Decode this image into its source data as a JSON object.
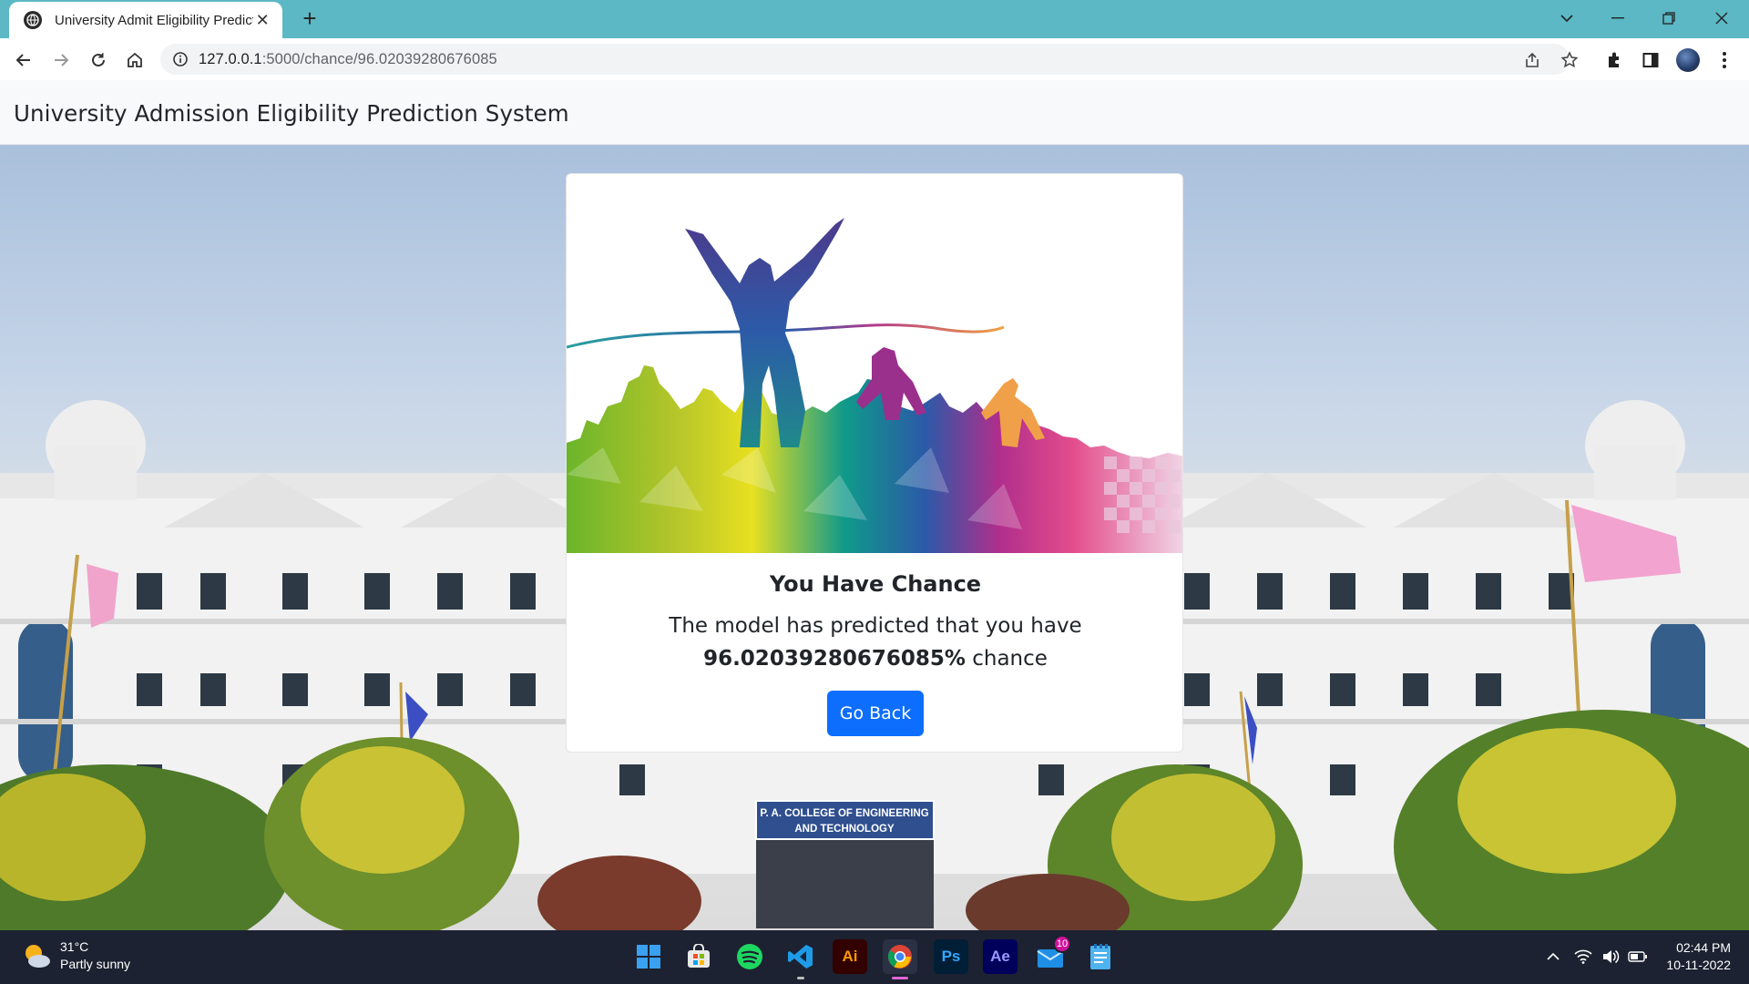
{
  "browser": {
    "tab_title": "University Admit Eligibility Prediction System",
    "url_host": "127.0.0.1",
    "url_rest": ":5000/chance/96.02039280676085",
    "icons": [
      "back-icon",
      "forward-icon",
      "reload-icon",
      "home-icon",
      "site-info-icon",
      "share-icon",
      "bookmark-star-icon",
      "extensions-icon",
      "side-panel-icon",
      "profile-avatar",
      "more-menu-icon"
    ]
  },
  "navbar": {
    "brand": "University Admission Eligibility Prediction System"
  },
  "result_card": {
    "title": "You Have Chance",
    "text_before": "The model has predicted that you have",
    "chance_value": "96.02039280676085%",
    "text_after": "chance",
    "button_label": "Go Back"
  },
  "hero": {
    "college_sign_line1": "P. A. COLLEGE OF ENGINEERING",
    "college_sign_line2": "AND TECHNOLOGY"
  },
  "taskbar": {
    "weather_temp": "31°C",
    "weather_desc": "Partly sunny",
    "apps": [
      "start-button",
      "microsoft-store",
      "spotify",
      "vs-code",
      "adobe-illustrator",
      "google-chrome",
      "adobe-photoshop",
      "adobe-after-effects",
      "mail",
      "notepad"
    ],
    "illustrator_label": "Ai",
    "photoshop_label": "Ps",
    "aftereffects_label": "Ae",
    "mail_badge": "10",
    "time": "02:44 PM",
    "date": "10-11-2022"
  },
  "colors": {
    "tab_strip": "#5bb8c4",
    "primary_button": "#0d6efd",
    "taskbar": "#1c2231"
  }
}
